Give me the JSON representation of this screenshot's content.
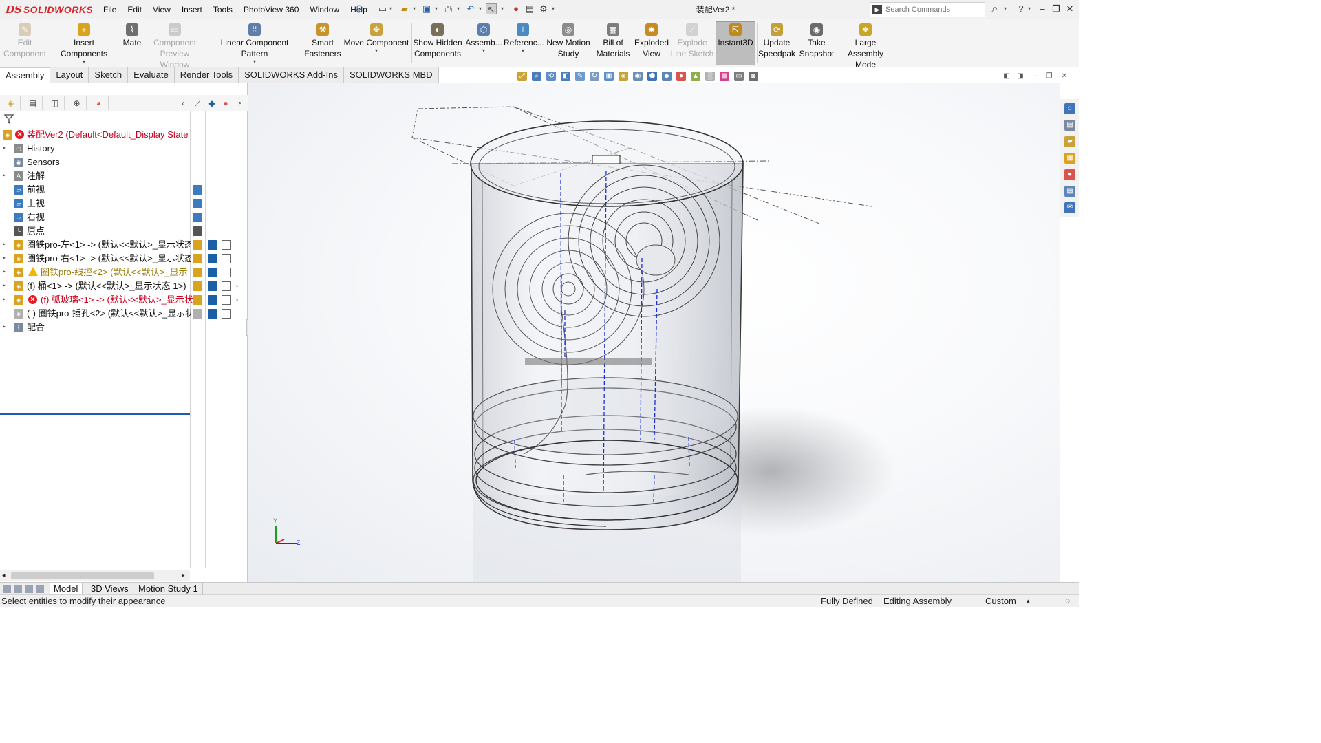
{
  "app": {
    "brand_mark": "DS",
    "brand_name": "SOLIDWORKS",
    "document_title": "装配Ver2 *"
  },
  "menu": [
    "File",
    "Edit",
    "View",
    "Insert",
    "Tools",
    "PhotoView 360",
    "Window",
    "Help"
  ],
  "search": {
    "placeholder": "Search Commands"
  },
  "ribbon": {
    "edit_component": "Edit Component",
    "insert_components": "Insert Components",
    "mate": "Mate",
    "component_preview": "Component Preview Window",
    "linear_pattern": "Linear Component Pattern",
    "smart_fasteners": "Smart Fasteners",
    "move_component": "Move Component",
    "show_hidden": "Show Hidden Components",
    "assembly_features": "Assemb...",
    "reference_geometry": "Referenc...",
    "new_motion_study": "New Motion Study",
    "bill_of_materials": "Bill of Materials",
    "exploded_view": "Exploded View",
    "explode_line_sketch": "Explode Line Sketch",
    "instant3d": "Instant3D",
    "update_speedpak": "Update Speedpak",
    "take_snapshot": "Take Snapshot",
    "large_assembly_mode": "Large Assembly Mode"
  },
  "cm_tabs": [
    "Assembly",
    "Layout",
    "Sketch",
    "Evaluate",
    "Render Tools",
    "SOLIDWORKS Add-Ins",
    "SOLIDWORKS MBD"
  ],
  "tree": {
    "root": "装配Ver2  (Default<Default_Display State",
    "items": [
      "History",
      "Sensors",
      "注解",
      "前视",
      "上视",
      "右视",
      "原点",
      "圈铁pro-左<1> -> (默认<<默认>_显示状态",
      "圈铁pro-右<1> -> (默认<<默认>_显示状态",
      "圈铁pro-线控<2> (默认<<默认>_显示",
      "(f) 桶<1> -> (默认<<默认>_显示状态 1>)",
      "(f) 弧玻璃<1> -> (默认<<默认>_显示状",
      "(-) 圈铁pro-插孔<2> (默认<<默认>_显示状",
      "配合"
    ]
  },
  "triad": {
    "y": "Y",
    "z": "Z"
  },
  "bottom_tabs": [
    "Model",
    "3D Views",
    "Motion Study 1"
  ],
  "status": {
    "hint": "Select entities to modify their appearance",
    "definition": "Fully Defined",
    "mode": "Editing Assembly",
    "units": "Custom"
  },
  "colors": {
    "brand": "#d8232a",
    "accent": "#1f5bb5",
    "error": "#c8001e",
    "warning": "#9a7b00"
  }
}
